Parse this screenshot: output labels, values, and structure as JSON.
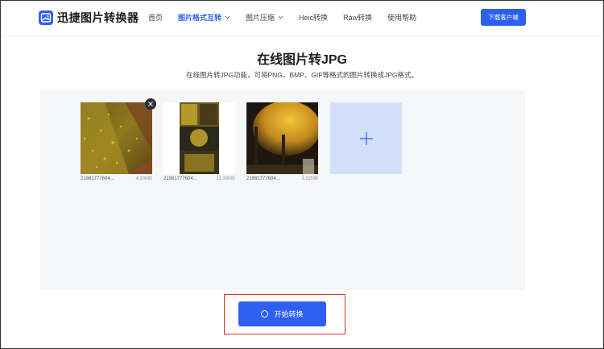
{
  "app": {
    "name": "迅捷图片转换器",
    "download_label": "下载客户端"
  },
  "nav": [
    {
      "label": "首页",
      "active": false,
      "has_dropdown": false
    },
    {
      "label": "图片格式互转",
      "active": true,
      "has_dropdown": true
    },
    {
      "label": "图片压缩",
      "active": false,
      "has_dropdown": true
    },
    {
      "label": "Heic转换",
      "active": false,
      "has_dropdown": false
    },
    {
      "label": "Raw转换",
      "active": false,
      "has_dropdown": false
    },
    {
      "label": "使用帮助",
      "active": false,
      "has_dropdown": false
    }
  ],
  "page": {
    "title": "在线图片转JPG",
    "subtitle": "在线图片转JPG功能，可将PNG、BMP、GIF等格式的图片转换成JPG格式。"
  },
  "files": [
    {
      "name": "21981777604...",
      "size": "4.30MB"
    },
    {
      "name": "21981777604...",
      "size": "11.38MB"
    },
    {
      "name": "21981777604...",
      "size": "3.52MB"
    }
  ],
  "actions": {
    "start_label": "开始转换",
    "add_symbol": "+"
  },
  "colors": {
    "accent": "#2d5ff5",
    "highlight": "#e02b2b",
    "add_tile": "#d3e0fb",
    "area_bg": "#f5f6f8"
  },
  "icons": {
    "logo": "image-logo-icon",
    "remove": "close-icon",
    "add": "plus-icon",
    "spinner": "loading-icon",
    "dropdown": "chevron-down-icon"
  }
}
